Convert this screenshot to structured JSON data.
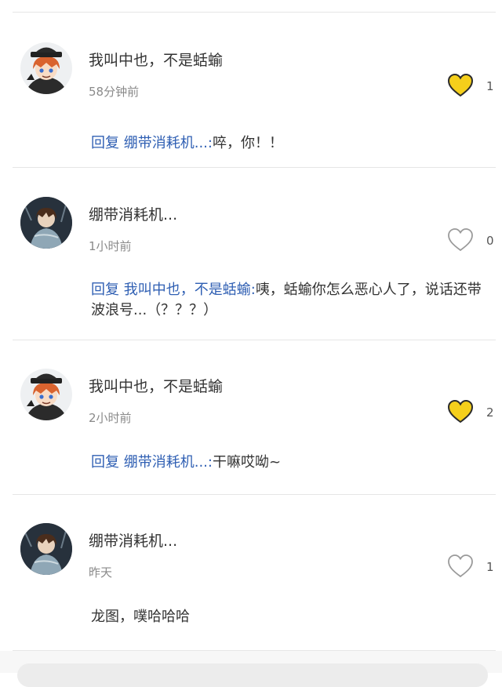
{
  "comments": [
    {
      "avatar": "chuuya-avatar",
      "username": "我叫中也，不是蛞蝓",
      "time": "58分钟前",
      "liked": true,
      "like_count": "1",
      "reply_prefix": "回复",
      "reply_target": "绷带消耗机...:",
      "reply_text": "啐，你！！"
    },
    {
      "avatar": "dazai-avatar",
      "username": "绷带消耗机...",
      "time": "1小时前",
      "liked": false,
      "like_count": "0",
      "reply_prefix": "回复",
      "reply_target": "我叫中也，不是蛞蝓:",
      "reply_text": "咦，蛞蝓你怎么恶心人了，说话还带波浪号...（？？？）"
    },
    {
      "avatar": "chuuya-avatar",
      "username": "我叫中也，不是蛞蝓",
      "time": "2小时前",
      "liked": true,
      "like_count": "2",
      "reply_prefix": "回复",
      "reply_target": "绷带消耗机...:",
      "reply_text": "干嘛哎呦~"
    },
    {
      "avatar": "dazai-avatar",
      "username": "绷带消耗机...",
      "time": "昨天",
      "liked": false,
      "like_count": "1",
      "reply_prefix": "",
      "reply_target": "",
      "reply_text": "龙图，噗哈哈哈"
    }
  ],
  "colors": {
    "like_active": "#f5cf1b",
    "like_inactive": "#9a9a9a",
    "reply_link": "#2f5fb3"
  }
}
